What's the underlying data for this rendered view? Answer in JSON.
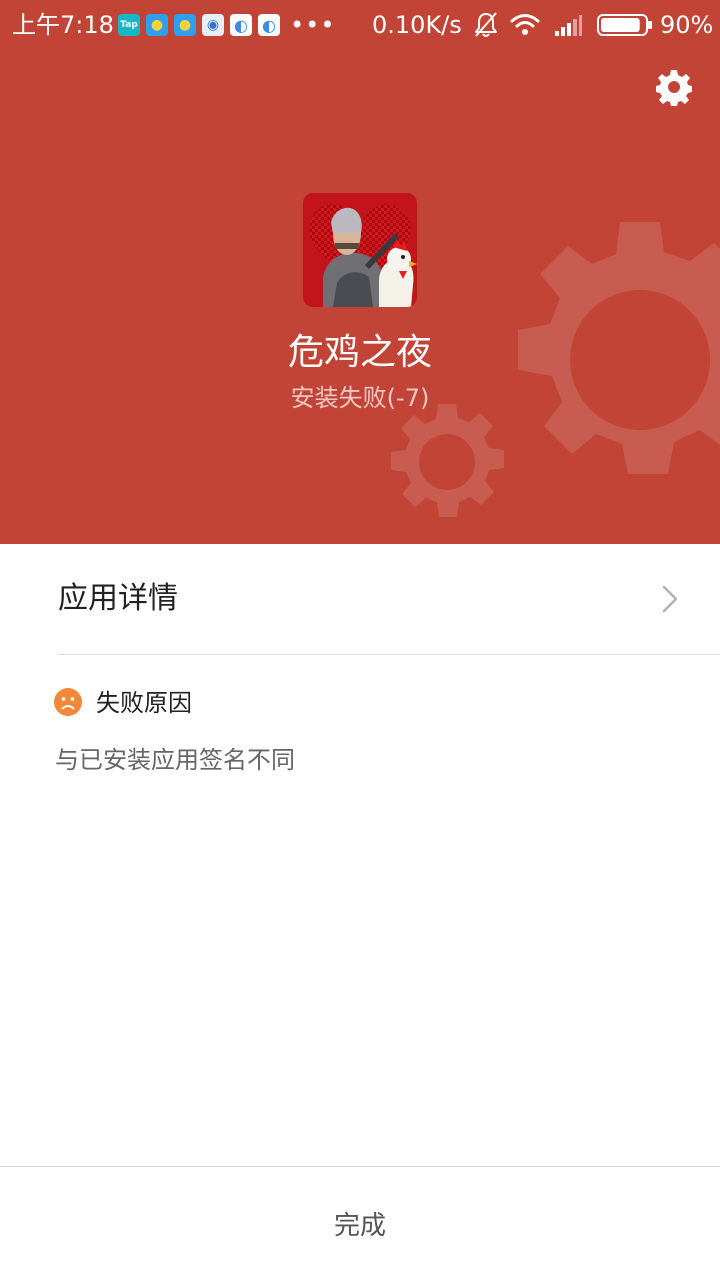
{
  "status_bar": {
    "time": "上午7:18",
    "more": "•••",
    "network_speed": "0.10K/s",
    "battery": "90%",
    "battery_level": 0.9,
    "notification_icons": [
      "taptap-icon",
      "qq-icon",
      "qq-icon",
      "app-store-icon",
      "browser-icon",
      "browser-icon"
    ],
    "notification_label_tap": "Tap"
  },
  "header": {
    "app_name": "危鸡之夜",
    "install_status": "安装失败(-7)",
    "background_color": "#c14436"
  },
  "details": {
    "label": "应用详情"
  },
  "failure": {
    "title": "失败原因",
    "reason": "与已安装应用签名不同",
    "icon_color": "#f3883a"
  },
  "footer": {
    "done_label": "完成"
  }
}
